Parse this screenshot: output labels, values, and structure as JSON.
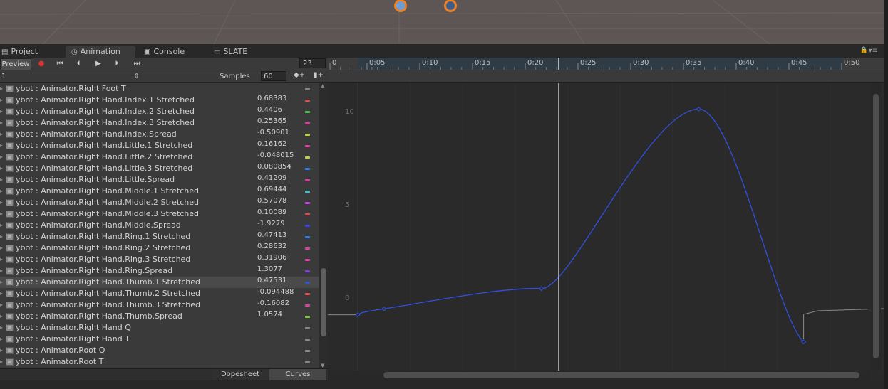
{
  "tabs": [
    {
      "label": "Project",
      "icon": "folder-icon",
      "active": false
    },
    {
      "label": "Animation",
      "icon": "clock-icon",
      "active": true
    },
    {
      "label": "Console",
      "icon": "console-icon",
      "active": false
    },
    {
      "label": "SLATE",
      "icon": "slate-icon",
      "active": false
    }
  ],
  "toolbar": {
    "preview_label": "Preview",
    "frame": "23"
  },
  "clip": {
    "selected": "1",
    "samples_label": "Samples",
    "samples_value": "60"
  },
  "properties": [
    {
      "name": "ybot : Animator.Right Foot T",
      "value": "",
      "color": "#8a8a8a"
    },
    {
      "name": "ybot : Animator.Right Hand.Index.1 Stretched",
      "value": "0.68383",
      "color": "#e05050"
    },
    {
      "name": "ybot : Animator.Right Hand.Index.2 Stretched",
      "value": "0.4406",
      "color": "#40c040"
    },
    {
      "name": "ybot : Animator.Right Hand.Index.3 Stretched",
      "value": "0.25365",
      "color": "#e040a0"
    },
    {
      "name": "ybot : Animator.Right Hand.Index.Spread",
      "value": "-0.50901",
      "color": "#c8d040"
    },
    {
      "name": "ybot : Animator.Right Hand.Little.1 Stretched",
      "value": "0.16162",
      "color": "#e040a0"
    },
    {
      "name": "ybot : Animator.Right Hand.Little.2 Stretched",
      "value": "-0.048015",
      "color": "#c8d040"
    },
    {
      "name": "ybot : Animator.Right Hand.Little.3 Stretched",
      "value": "0.080854",
      "color": "#3080e0"
    },
    {
      "name": "ybot : Animator.Right Hand.Little.Spread",
      "value": "0.41209",
      "color": "#e040a0"
    },
    {
      "name": "ybot : Animator.Right Hand.Middle.1 Stretched",
      "value": "0.69444",
      "color": "#40c0c0"
    },
    {
      "name": "ybot : Animator.Right Hand.Middle.2 Stretched",
      "value": "0.57078",
      "color": "#c040e0"
    },
    {
      "name": "ybot : Animator.Right Hand.Middle.3 Stretched",
      "value": "0.10089",
      "color": "#e05050"
    },
    {
      "name": "ybot : Animator.Right Hand.Middle.Spread",
      "value": "-1.9279",
      "color": "#4040e0"
    },
    {
      "name": "ybot : Animator.Right Hand.Ring.1 Stretched",
      "value": "0.47413",
      "color": "#3080e0"
    },
    {
      "name": "ybot : Animator.Right Hand.Ring.2 Stretched",
      "value": "0.28632",
      "color": "#e040a0"
    },
    {
      "name": "ybot : Animator.Right Hand.Ring.3 Stretched",
      "value": "0.31906",
      "color": "#e040a0"
    },
    {
      "name": "ybot : Animator.Right Hand.Ring.Spread",
      "value": "1.3077",
      "color": "#8040e0"
    },
    {
      "name": "ybot : Animator.Right Hand.Thumb.1 Stretched",
      "value": "0.47531",
      "color": "#3050e0",
      "selected": true
    },
    {
      "name": "ybot : Animator.Right Hand.Thumb.2 Stretched",
      "value": "-0.094488",
      "color": "#e05050"
    },
    {
      "name": "ybot : Animator.Right Hand.Thumb.3 Stretched",
      "value": "-0.16082",
      "color": "#e040a0"
    },
    {
      "name": "ybot : Animator.Right Hand.Thumb.Spread",
      "value": "1.0574",
      "color": "#80c040"
    },
    {
      "name": "ybot : Animator.Right Hand Q",
      "value": "",
      "color": "#8a8a8a"
    },
    {
      "name": "ybot : Animator.Right Hand T",
      "value": "",
      "color": "#8a8a8a"
    },
    {
      "name": "ybot : Animator.Root Q",
      "value": "",
      "color": "#8a8a8a"
    },
    {
      "name": "ybot : Animator.Root T",
      "value": "",
      "color": "#8a8a8a"
    }
  ],
  "bottom_tabs": {
    "dopesheet": "Dopesheet",
    "curves": "Curves"
  },
  "timeline": {
    "labels": [
      "0",
      "0:05",
      "0:10",
      "0:15",
      "0:20",
      "0:25",
      "0:30",
      "0:35",
      "0:40",
      "0:45",
      "0:50"
    ],
    "playhead_seconds": 0.383
  },
  "curve": {
    "color": "#3050e0",
    "y_labels": [
      "10",
      "5",
      "0"
    ],
    "keys": [
      {
        "t": 0.0,
        "v": -0.94
      },
      {
        "t": 0.05,
        "v": -0.62
      },
      {
        "t": 0.35,
        "v": 0.47
      },
      {
        "t": 0.65,
        "v": 10.1
      },
      {
        "t": 0.85,
        "v": -2.4
      }
    ]
  }
}
